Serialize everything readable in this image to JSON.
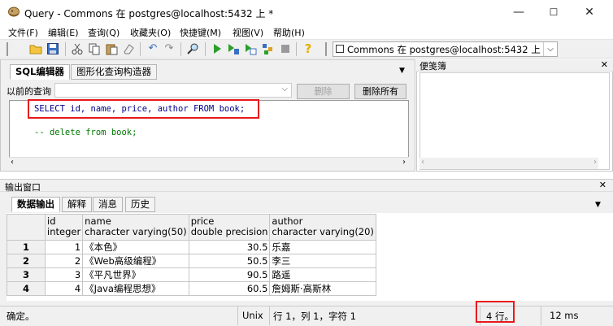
{
  "window": {
    "title": "Query - Commons 在 postgres@localhost:5432 上 *",
    "minimize_glyph": "—",
    "maximize_glyph": "☐",
    "close_glyph": "✕"
  },
  "menu": [
    "文件(F)",
    "编辑(E)",
    "查询(Q)",
    "收藏夹(O)",
    "快捷键(M)",
    "视图(V)",
    "帮助(H)"
  ],
  "toolbar": {
    "connection_label": "Commons 在  postgres@localhost:5432 上",
    "dropdown_glyph": "⌵"
  },
  "editor": {
    "tabs": [
      "SQL编辑器",
      "图形化查询构造器"
    ],
    "history_label": "以前的查询",
    "delete_label": "删除",
    "delete_all_label": "删除所有",
    "code_lines": [
      "SELECT id, name, price, author FROM book;",
      "-- delete from book;"
    ]
  },
  "clipboard": {
    "title": "便笺簿"
  },
  "output": {
    "title": "输出窗口",
    "tabs": [
      "数据输出",
      "解释",
      "消息",
      "历史"
    ],
    "columns": [
      {
        "name": "id",
        "type": "integer"
      },
      {
        "name": "name",
        "type": "character varying(50)"
      },
      {
        "name": "price",
        "type": "double precision"
      },
      {
        "name": "author",
        "type": "character varying(20)"
      }
    ],
    "rows": [
      {
        "n": "1",
        "id": "1",
        "name": "《本色》",
        "price": "30.5",
        "author": "乐嘉"
      },
      {
        "n": "2",
        "id": "2",
        "name": "《Web高级编程》",
        "price": "50.5",
        "author": "李三"
      },
      {
        "n": "3",
        "id": "3",
        "name": "《平凡世界》",
        "price": "90.5",
        "author": "路遥"
      },
      {
        "n": "4",
        "id": "4",
        "name": "《Java编程思想》",
        "price": "60.5",
        "author": "詹姆斯·高斯林"
      }
    ]
  },
  "status": {
    "state": "确定。",
    "encoding": "Unix",
    "position": "行 1，列 1，字符 1",
    "rows": "4 行。",
    "time": "12 ms"
  }
}
